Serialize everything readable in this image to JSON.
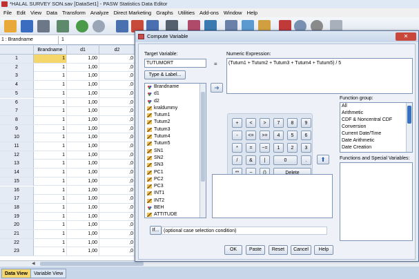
{
  "window": {
    "title": "*HALAL SURVEY SON.sav [DataSet1] - PASW Statistics Data Editor"
  },
  "menu": [
    "File",
    "Edit",
    "View",
    "Data",
    "Transform",
    "Analyze",
    "Direct Marketing",
    "Graphs",
    "Utilities",
    "Add-ons",
    "Window",
    "Help"
  ],
  "cell_ref": {
    "name": "1 : Brandname",
    "value": "1"
  },
  "grid": {
    "columns": [
      "Brandname",
      "d1",
      "d2"
    ],
    "rows": [
      [
        "1",
        "1",
        "1,00",
        ",0"
      ],
      [
        "2",
        "1",
        "1,00",
        ",0"
      ],
      [
        "3",
        "1",
        "1,00",
        ",0"
      ],
      [
        "4",
        "1",
        "1,00",
        ",0"
      ],
      [
        "5",
        "1",
        "1,00",
        ",0"
      ],
      [
        "6",
        "1",
        "1,00",
        ",0"
      ],
      [
        "7",
        "1",
        "1,00",
        ",0"
      ],
      [
        "8",
        "1",
        "1,00",
        ",0"
      ],
      [
        "9",
        "1",
        "1,00",
        ",0"
      ],
      [
        "10",
        "1",
        "1,00",
        ",0"
      ],
      [
        "11",
        "1",
        "1,00",
        ",0"
      ],
      [
        "12",
        "1",
        "1,00",
        ",0"
      ],
      [
        "13",
        "1",
        "1,00",
        ",0"
      ],
      [
        "14",
        "1",
        "1,00",
        ",0"
      ],
      [
        "15",
        "1",
        "1,00",
        ",0"
      ],
      [
        "16",
        "1",
        "1,00",
        ",0"
      ],
      [
        "17",
        "1",
        "1,00",
        ",0"
      ],
      [
        "18",
        "1",
        "1,00",
        ",0"
      ],
      [
        "19",
        "1",
        "1,00",
        ",0"
      ],
      [
        "20",
        "1",
        "1,00",
        ",0"
      ],
      [
        "21",
        "1",
        "1,00",
        ",0"
      ],
      [
        "22",
        "1",
        "1,00",
        ",0"
      ],
      [
        "23",
        "1",
        "1,00",
        ",0"
      ]
    ]
  },
  "tabs": {
    "data_view": "Data View",
    "variable_view": "Variable View"
  },
  "dialog": {
    "title": "Compute Variable",
    "target_label": "Target Variable:",
    "target_value": "TUTUMORT",
    "equals": "=",
    "type_label": "Type & Label...",
    "numexp_label": "Numeric Expression:",
    "numexp_value": "(Tutum1 + Tutum2 + Tutum3 + Tutum4 + Tutum5) / 5",
    "variables": [
      {
        "name": "Brandname",
        "kind": "nominal"
      },
      {
        "name": "d1",
        "kind": "nominal"
      },
      {
        "name": "d2",
        "kind": "nominal"
      },
      {
        "name": "kraldummy",
        "kind": "scale"
      },
      {
        "name": "Tutum1",
        "kind": "scale"
      },
      {
        "name": "Tutum2",
        "kind": "scale"
      },
      {
        "name": "Tutum3",
        "kind": "scale"
      },
      {
        "name": "Tutum4",
        "kind": "scale"
      },
      {
        "name": "Tutum5",
        "kind": "scale"
      },
      {
        "name": "SN1",
        "kind": "scale"
      },
      {
        "name": "SN2",
        "kind": "scale"
      },
      {
        "name": "SN3",
        "kind": "scale"
      },
      {
        "name": "PC1",
        "kind": "scale"
      },
      {
        "name": "PC2",
        "kind": "scale"
      },
      {
        "name": "PC3",
        "kind": "scale"
      },
      {
        "name": "INT1",
        "kind": "scale"
      },
      {
        "name": "INT2",
        "kind": "scale"
      },
      {
        "name": "BEH",
        "kind": "nominal"
      },
      {
        "name": "ATTITUDE",
        "kind": "scale"
      }
    ],
    "keypad": {
      "row1": [
        "+",
        "<",
        ">",
        "7",
        "8",
        "9"
      ],
      "row2": [
        "-",
        "<=",
        ">=",
        "4",
        "5",
        "6"
      ],
      "row3": [
        "*",
        "=",
        "~=",
        "1",
        "2",
        "3"
      ],
      "row4": [
        "/",
        "&",
        "|",
        "0",
        "."
      ],
      "row5": [
        "**",
        "~",
        "()",
        "Delete"
      ]
    },
    "function_group_label": "Function group:",
    "function_groups": [
      "All",
      "Arithmetic",
      "CDF & Noncentral CDF",
      "Conversion",
      "Current Date/Time",
      "Date Arithmetic",
      "Date Creation"
    ],
    "functions_label": "Functions and Special Variables:",
    "if_button": "If...",
    "if_text": "(optional case selection condition)",
    "buttons": {
      "ok": "OK",
      "paste": "Paste",
      "reset": "Reset",
      "cancel": "Cancel",
      "help": "Help"
    }
  },
  "colors": {
    "accent": "#2860b0",
    "grid_header": "#e4ebf5",
    "dialog_bg": "#e3eaf4"
  }
}
